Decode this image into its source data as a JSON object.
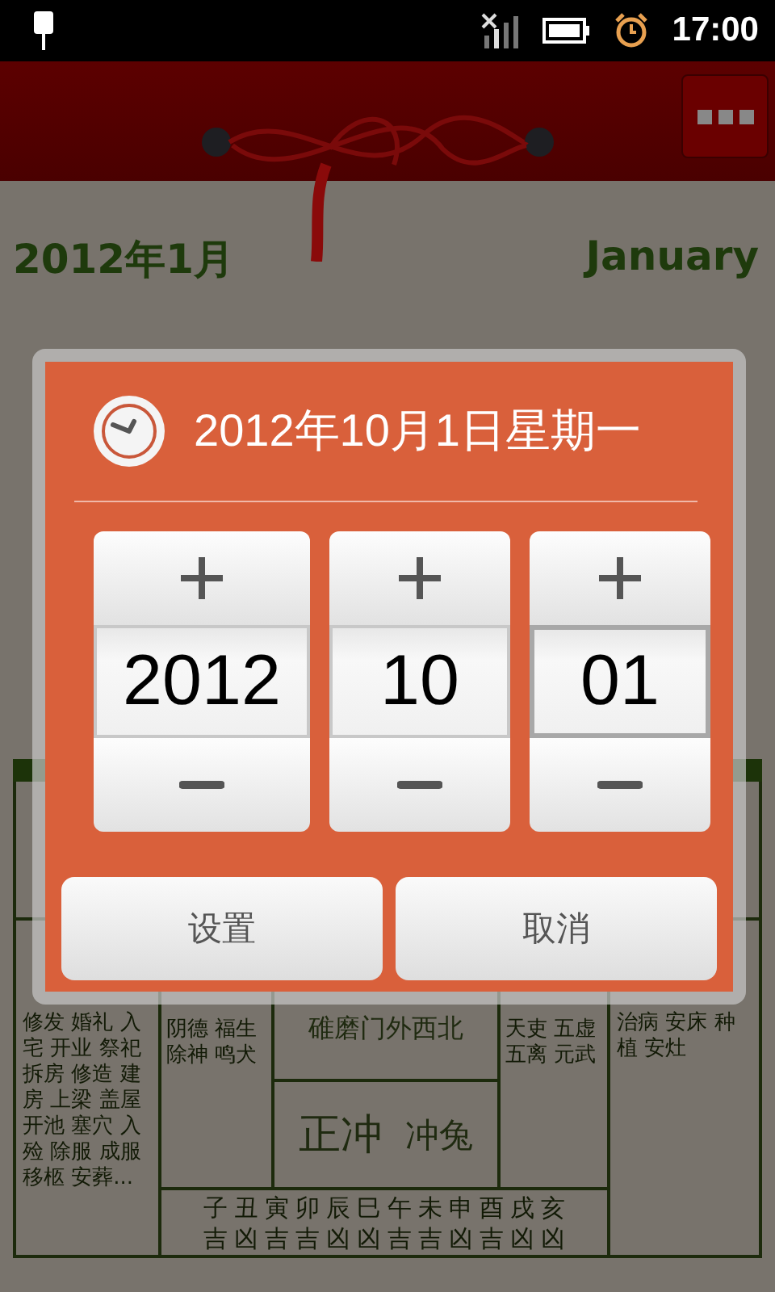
{
  "status_bar": {
    "time": "17:00"
  },
  "calendar": {
    "month_title": "2012年1月",
    "month_english": "January",
    "almanac": {
      "suitable": "修发 婚礼 入宅 开业 祭祀拆房 修造 建房 上梁 盖屋开池 塞穴 入殓 除服 成服移柩 安葬...",
      "auspicious_gods": "阴德 福生除神 鸣犬",
      "fetal_god": "碓磨门外西北",
      "clash": "正冲",
      "clash_animal": "冲兔",
      "inauspicious_gods": "天吏 五虚五离 元武",
      "avoid": "治病 安床 种植 安灶",
      "hours": [
        {
          "branch": "子",
          "luck": "吉"
        },
        {
          "branch": "丑",
          "luck": "凶"
        },
        {
          "branch": "寅",
          "luck": "吉"
        },
        {
          "branch": "卯",
          "luck": "吉"
        },
        {
          "branch": "辰",
          "luck": "凶"
        },
        {
          "branch": "巳",
          "luck": "凶"
        },
        {
          "branch": "午",
          "luck": "吉"
        },
        {
          "branch": "未",
          "luck": "吉"
        },
        {
          "branch": "申",
          "luck": "凶"
        },
        {
          "branch": "酉",
          "luck": "吉"
        },
        {
          "branch": "戌",
          "luck": "凶"
        },
        {
          "branch": "亥",
          "luck": "凶"
        }
      ]
    }
  },
  "dialog": {
    "title": "2012年10月1日星期一",
    "spinners": [
      {
        "value": "2012",
        "selected": false
      },
      {
        "value": "10",
        "selected": false
      },
      {
        "value": "01",
        "selected": true
      }
    ],
    "buttons": [
      "设置",
      "取消"
    ]
  }
}
